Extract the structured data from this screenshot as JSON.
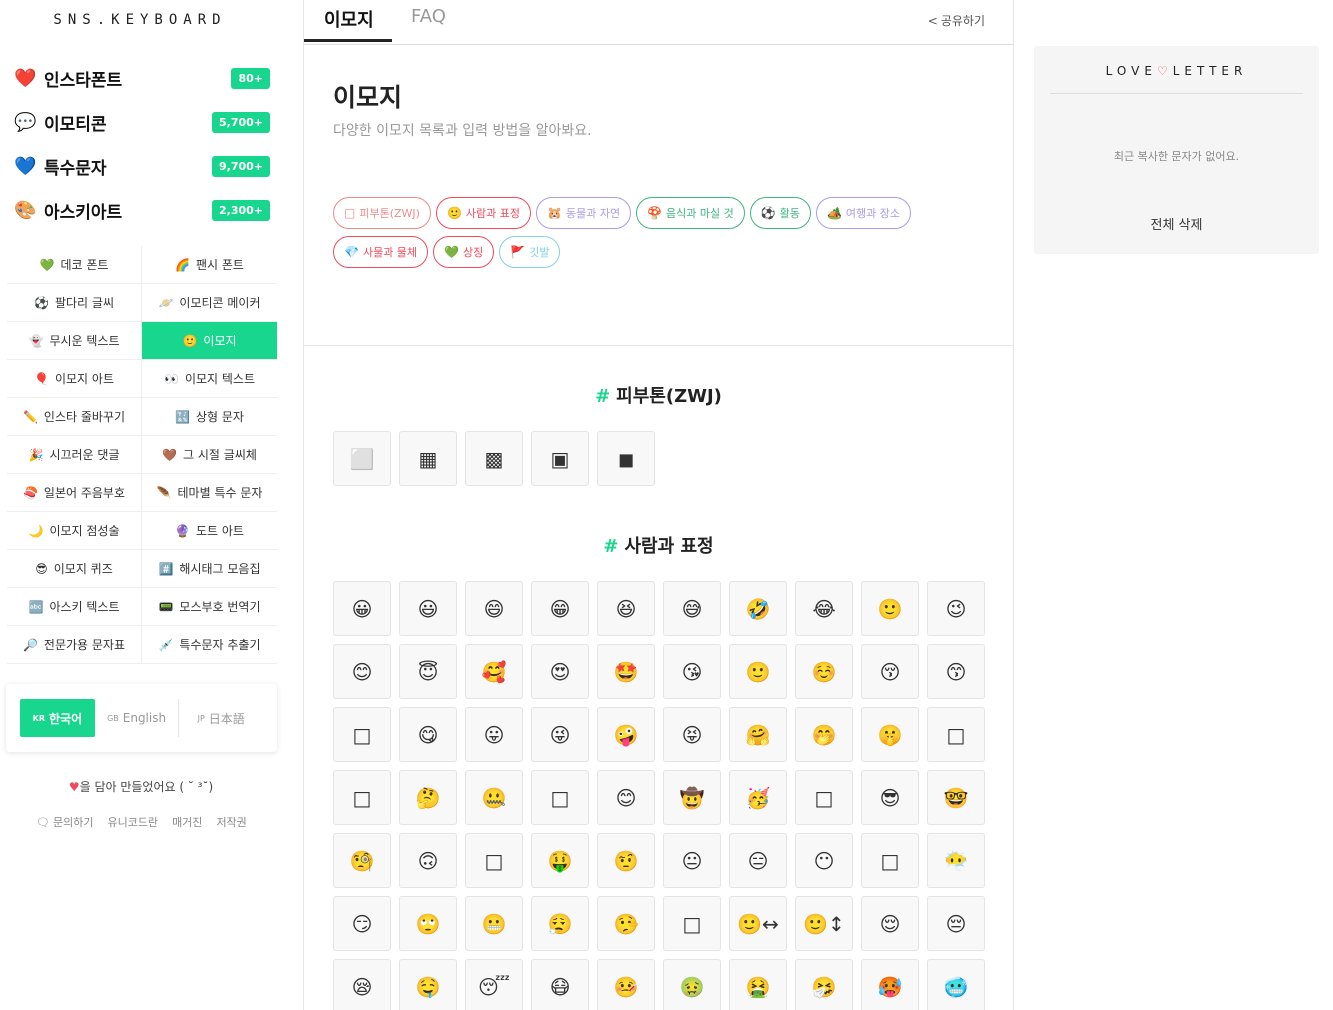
{
  "logo": "SNS.KEYBOARD",
  "main_nav": [
    {
      "icon": "❤️",
      "label": "인스타폰트",
      "badge": "80+"
    },
    {
      "icon": "💬",
      "label": "이모티콘",
      "badge": "5,700+"
    },
    {
      "icon": "💙",
      "label": "특수문자",
      "badge": "9,700+"
    },
    {
      "icon": "🎨",
      "label": "아스키아트",
      "badge": "2,300+"
    }
  ],
  "sub_nav": [
    {
      "icon": "💚",
      "label": "데코 폰트"
    },
    {
      "icon": "🌈",
      "label": "팬시 폰트"
    },
    {
      "icon": "⚽",
      "label": "팔다리 글씨"
    },
    {
      "icon": "🪐",
      "label": "이모티콘 메이커"
    },
    {
      "icon": "👻",
      "label": "무시운 텍스트"
    },
    {
      "icon": "🙂",
      "label": "이모지"
    },
    {
      "icon": "🎈",
      "label": "이모지 아트"
    },
    {
      "icon": "👀",
      "label": "이모지 텍스트"
    },
    {
      "icon": "✏️",
      "label": "인스타 줄바꾸기"
    },
    {
      "icon": "🔣",
      "label": "상형 문자"
    },
    {
      "icon": "🎉",
      "label": "시끄러운 댓글"
    },
    {
      "icon": "🤎",
      "label": "그 시절 글씨체"
    },
    {
      "icon": "🍣",
      "label": "일본어 주음부호"
    },
    {
      "icon": "🪶",
      "label": "테마별 특수 문자"
    },
    {
      "icon": "🌙",
      "label": "이모지 점성술"
    },
    {
      "icon": "🔮",
      "label": "도트 아트"
    },
    {
      "icon": "😎",
      "label": "이모지 퀴즈"
    },
    {
      "icon": "#️⃣",
      "label": "해시태그 모음집"
    },
    {
      "icon": "🔤",
      "label": "아스키 텍스트"
    },
    {
      "icon": "📟",
      "label": "모스부호 번역기"
    },
    {
      "icon": "🔎",
      "label": "전문가용 문자표"
    },
    {
      "icon": "💉",
      "label": "특수문자 추출기"
    }
  ],
  "languages": [
    {
      "code": "KR",
      "label": "한국어"
    },
    {
      "code": "GB",
      "label": "English"
    },
    {
      "code": "JP",
      "label": "日本語"
    }
  ],
  "footer": {
    "heart": "♥",
    "made_with": "을 담아 만들었어요 ( ˘ ³˘)",
    "links": [
      "문의하기",
      "유니코드란",
      "매거진",
      "저작권"
    ]
  },
  "tabs": [
    "이모지",
    "FAQ"
  ],
  "share_label": "공유하기",
  "page": {
    "title": "이모지",
    "description": "다양한 이모지 목록과 입력 방법을 알아봐요."
  },
  "chips": [
    {
      "icon": "□",
      "label": "피부톤(ZWJ)",
      "color": "#f08a8a"
    },
    {
      "icon": "🙂",
      "label": "사람과 표정",
      "color": "#ef4b5c"
    },
    {
      "icon": "🐹",
      "label": "동물과 자연",
      "color": "#a89de8"
    },
    {
      "icon": "🍄",
      "label": "음식과 마실 것",
      "color": "#3fb57f"
    },
    {
      "icon": "⚽",
      "label": "활동",
      "color": "#3fb57f"
    },
    {
      "icon": "🏕️",
      "label": "여행과 장소",
      "color": "#a89de8"
    },
    {
      "icon": "💎",
      "label": "사물과 물체",
      "color": "#ef4b5c"
    },
    {
      "icon": "💚",
      "label": "상징",
      "color": "#ef4b5c"
    },
    {
      "icon": "🚩",
      "label": "깃발",
      "color": "#7fd3e0"
    }
  ],
  "sections": [
    {
      "title": "피부톤(ZWJ)",
      "emojis": [
        "⬜",
        "▦",
        "▩",
        "▣",
        "◼"
      ]
    },
    {
      "title": "사람과 표정",
      "emojis": [
        "😀",
        "😃",
        "😄",
        "😁",
        "😆",
        "😅",
        "🤣",
        "😂",
        "🙂",
        "😉",
        "😊",
        "😇",
        "🥰",
        "😍",
        "🤩",
        "😘",
        "🙂",
        "☺️",
        "😚",
        "😙",
        "□",
        "😋",
        "😛",
        "😜",
        "🤪",
        "😝",
        "🤗",
        "🤭",
        "🤫",
        "□",
        "□",
        "🤔",
        "🤐",
        "□",
        "😊",
        "🤠",
        "🥳",
        "□",
        "😎",
        "🤓",
        "🧐",
        "🙃",
        "□",
        "🤑",
        "🤨",
        "😐",
        "😑",
        "😶",
        "□",
        "😶‍🌫️",
        "😏",
        "🙄",
        "😬",
        "😮‍💨",
        "🤥",
        "□",
        "🙂↔",
        "🙂↕",
        "😌",
        "😔",
        "😪",
        "🤤",
        "😴",
        "😷",
        "🤒",
        "🤢",
        "🤮",
        "🤧",
        "🥵",
        "🥶"
      ]
    }
  ],
  "love_letter": {
    "title_left": "LOVE",
    "heart": "♡",
    "title_right": "LETTER",
    "empty": "최근 복사한 문자가 없어요.",
    "clear": "전체 삭제"
  },
  "colors": {
    "accent": "#19d68f",
    "heart": "#ef4b5c"
  }
}
